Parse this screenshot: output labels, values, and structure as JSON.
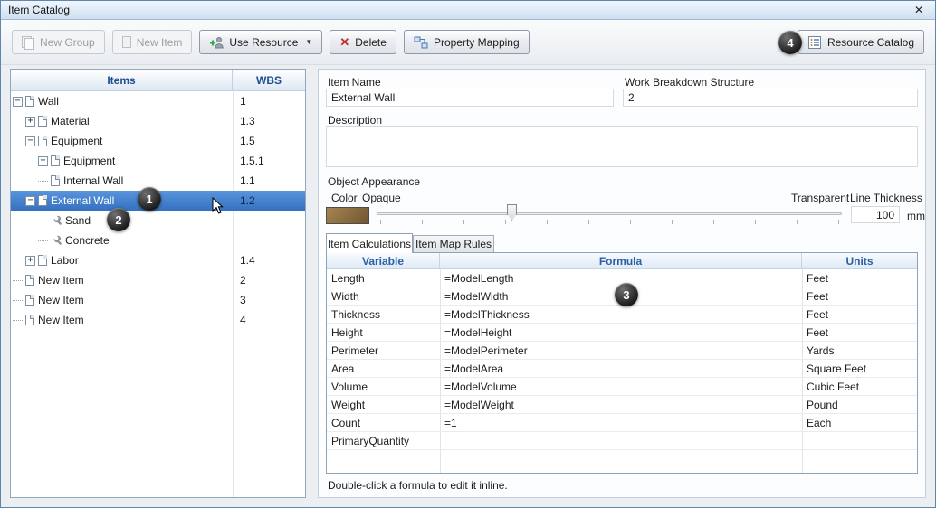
{
  "window": {
    "title": "Item Catalog"
  },
  "icons": {
    "close": "✕",
    "delete_x": "✕",
    "dropdown_arrow": "▼",
    "minus": "−",
    "plus": "+"
  },
  "toolbar": {
    "new_group": "New Group",
    "new_item": "New Item",
    "use_resource": "Use Resource",
    "delete": "Delete",
    "property_mapping": "Property Mapping",
    "resource_catalog": "Resource Catalog"
  },
  "tree": {
    "header": {
      "items": "Items",
      "wbs": "WBS"
    },
    "rows": [
      {
        "label": "Wall",
        "wbs": "1"
      },
      {
        "label": "Material",
        "wbs": "1.3"
      },
      {
        "label": "Equipment",
        "wbs": "1.5"
      },
      {
        "label": "Equipment",
        "wbs": "1.5.1"
      },
      {
        "label": "Internal Wall",
        "wbs": "1.1"
      },
      {
        "label": "External Wall",
        "wbs": "1.2"
      },
      {
        "label": "Sand",
        "wbs": ""
      },
      {
        "label": "Concrete",
        "wbs": ""
      },
      {
        "label": "Labor",
        "wbs": "1.4"
      },
      {
        "label": "New Item",
        "wbs": "2"
      },
      {
        "label": "New Item",
        "wbs": "3"
      },
      {
        "label": "New Item",
        "wbs": "4"
      }
    ]
  },
  "details": {
    "item_name_label": "Item Name",
    "item_name_value": "External Wall",
    "wbs_label": "Work Breakdown Structure",
    "wbs_value": "2",
    "description_label": "Description",
    "description_value": "",
    "appearance": {
      "title": "Object Appearance",
      "color_label": "Color",
      "opaque_label": "Opaque",
      "transparent_label": "Transparent",
      "line_thickness_label": "Line Thickness",
      "line_thickness_value": "100",
      "line_thickness_unit": "mm",
      "swatch_color": "#8d6f42",
      "slider_position_percent": 29
    },
    "tabs": {
      "calculations": "Item Calculations",
      "map_rules": "Item Map Rules"
    },
    "table": {
      "columns": [
        "Variable",
        "Formula",
        "Units"
      ],
      "rows": [
        {
          "variable": "Length",
          "formula": "=ModelLength",
          "units": "Feet"
        },
        {
          "variable": "Width",
          "formula": "=ModelWidth",
          "units": "Feet"
        },
        {
          "variable": "Thickness",
          "formula": "=ModelThickness",
          "units": "Feet"
        },
        {
          "variable": "Height",
          "formula": "=ModelHeight",
          "units": "Feet"
        },
        {
          "variable": "Perimeter",
          "formula": "=ModelPerimeter",
          "units": "Yards"
        },
        {
          "variable": "Area",
          "formula": "=ModelArea",
          "units": "Square Feet"
        },
        {
          "variable": "Volume",
          "formula": "=ModelVolume",
          "units": "Cubic Feet"
        },
        {
          "variable": "Weight",
          "formula": "=ModelWeight",
          "units": "Pound"
        },
        {
          "variable": "Count",
          "formula": "=1",
          "units": "Each"
        },
        {
          "variable": "PrimaryQuantity",
          "formula": "",
          "units": ""
        }
      ]
    },
    "hint": "Double-click a formula to edit it inline."
  },
  "callouts": [
    "1",
    "2",
    "3",
    "4"
  ]
}
